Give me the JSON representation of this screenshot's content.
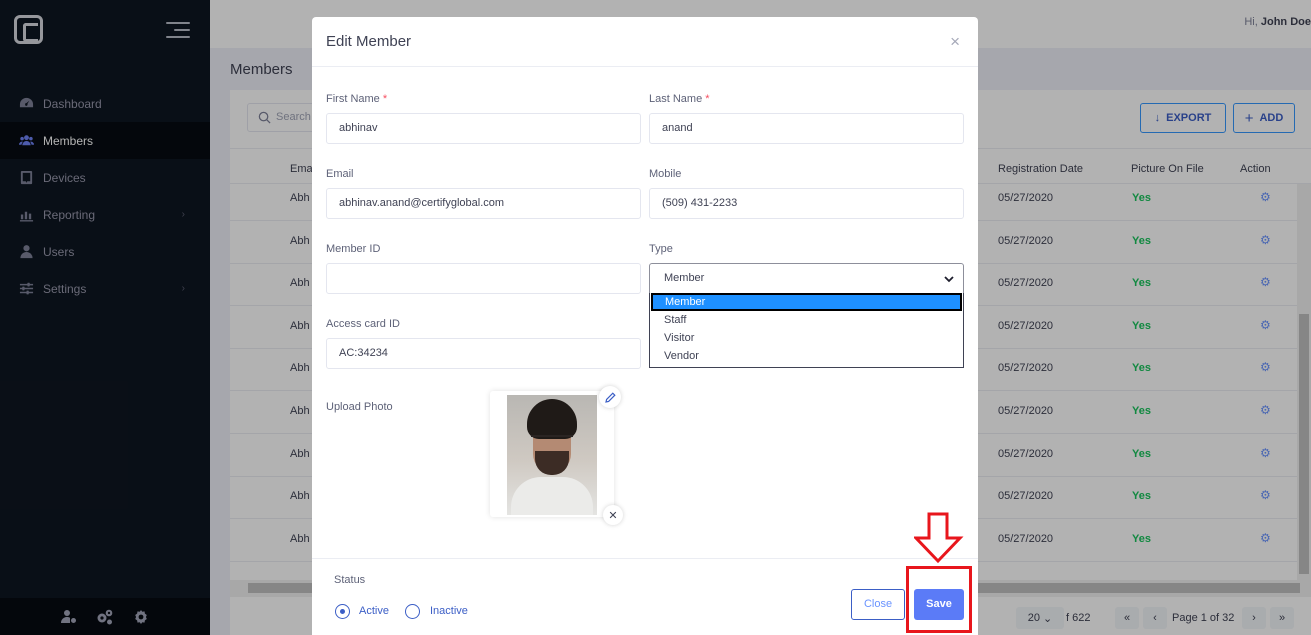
{
  "header": {
    "greeting": "Hi,",
    "user": "John Doe"
  },
  "sidebar": {
    "items": [
      {
        "label": "Dashboard",
        "icon": "dashboard-icon",
        "active": false
      },
      {
        "label": "Members",
        "icon": "users-icon",
        "active": true
      },
      {
        "label": "Devices",
        "icon": "tablet-icon",
        "active": false
      },
      {
        "label": "Reporting",
        "icon": "chart-icon",
        "active": false,
        "chevron": "›"
      },
      {
        "label": "Users",
        "icon": "user-icon",
        "active": false
      },
      {
        "label": "Settings",
        "icon": "sliders-icon",
        "active": false,
        "chevron": "›"
      }
    ],
    "footer_icons": [
      "user-settings-icon",
      "gears-icon",
      "gear-icon"
    ]
  },
  "page": {
    "title": "Members",
    "search_placeholder": "Search",
    "export_label": "EXPORT",
    "add_label": "ADD",
    "columns": {
      "email": "Ema",
      "registration_date": "Registration Date",
      "picture_on_file": "Picture On File",
      "action": "Action"
    },
    "rows": [
      {
        "email": "Abh",
        "date": "05/27/2020",
        "picture": "Yes"
      },
      {
        "email": "Abh",
        "date": "05/27/2020",
        "picture": "Yes"
      },
      {
        "email": "Abh",
        "date": "05/27/2020",
        "picture": "Yes"
      },
      {
        "email": "Abh",
        "date": "05/27/2020",
        "picture": "Yes"
      },
      {
        "email": "Abh",
        "date": "05/27/2020",
        "picture": "Yes"
      },
      {
        "email": "Abh",
        "date": "05/27/2020",
        "picture": "Yes"
      },
      {
        "email": "Abh",
        "date": "05/27/2020",
        "picture": "Yes"
      },
      {
        "email": "Abh",
        "date": "05/27/2020",
        "picture": "Yes"
      },
      {
        "email": "Abh",
        "date": "05/27/2020",
        "picture": "Yes"
      }
    ],
    "pagination": {
      "page_size": "20",
      "total": "f 622",
      "page_text": "Page 1 of 32",
      "first": "«",
      "prev": "‹",
      "next": "›",
      "last": "»"
    }
  },
  "modal": {
    "title": "Edit Member",
    "close_glyph": "×",
    "first_name": {
      "label": "First Name",
      "required": "*",
      "value": "abhinav"
    },
    "last_name": {
      "label": "Last Name",
      "required": "*",
      "value": "anand"
    },
    "email": {
      "label": "Email",
      "value": "abhinav.anand@certifyglobal.com"
    },
    "mobile": {
      "label": "Mobile",
      "value": "(509) 431-2233"
    },
    "member_id": {
      "label": "Member ID",
      "value": ""
    },
    "type": {
      "label": "Type",
      "value": "Member",
      "options": [
        "Member",
        "Staff",
        "Visitor",
        "Vendor"
      ]
    },
    "access_card": {
      "label": "Access card ID",
      "value": "AC:34234"
    },
    "upload_photo_label": "Upload Photo",
    "status": {
      "label": "Status",
      "options": [
        "Active",
        "Inactive"
      ],
      "selected": "Active"
    },
    "close_label": "Close",
    "save_label": "Save"
  },
  "colors": {
    "accent": "#5b7bf7",
    "highlight": "#e8161c",
    "success": "#1bc55e",
    "sidebar": "#0e1621"
  }
}
